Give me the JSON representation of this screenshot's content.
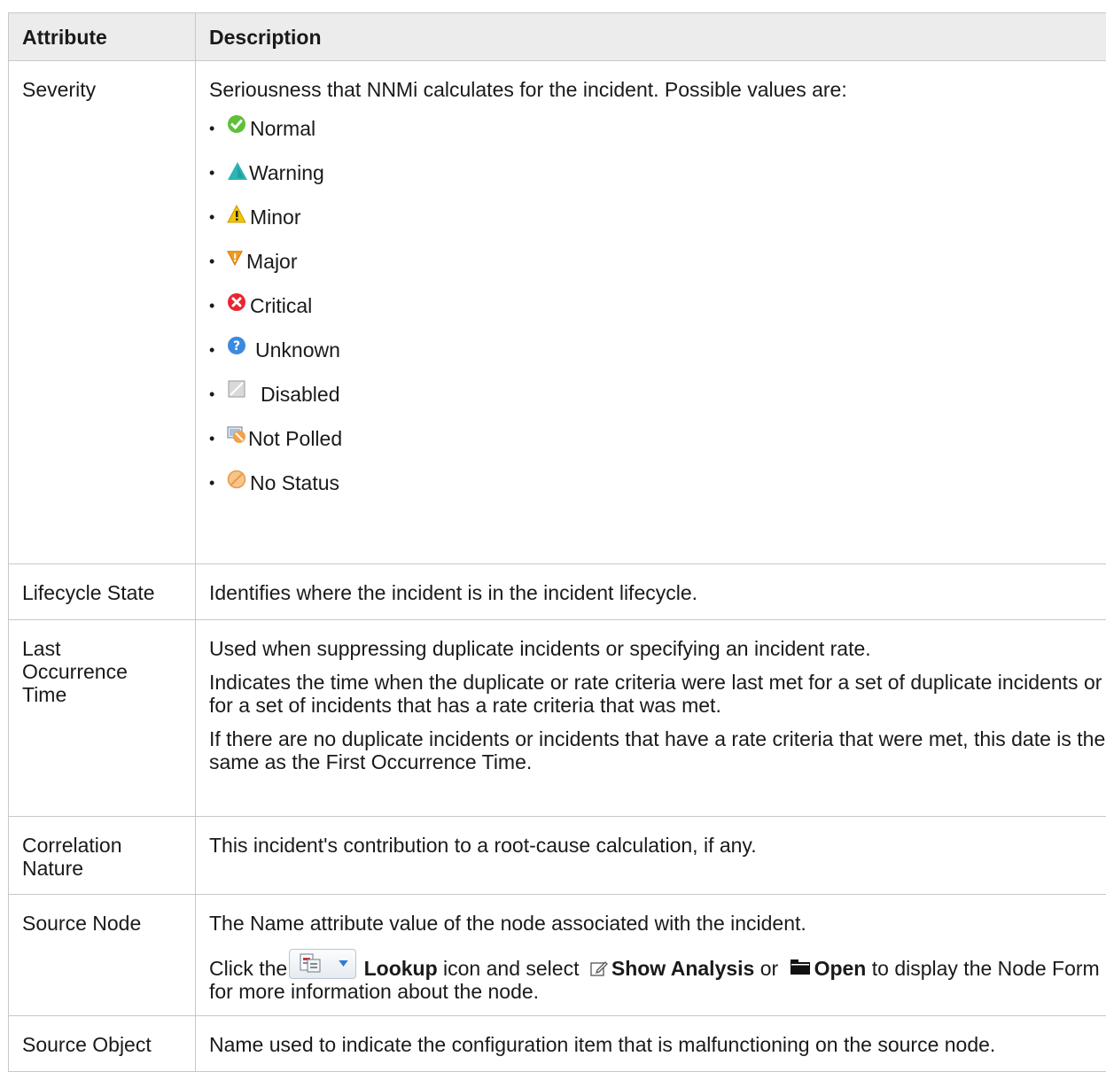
{
  "table": {
    "headers": {
      "attribute": "Attribute",
      "description": "Description"
    },
    "severity": {
      "attribute": "Severity",
      "intro": "Seriousness that NNMi calculates for the incident. Possible values are:",
      "values": [
        {
          "label": "Normal",
          "icon": "check-circle-icon",
          "color": "#5fbf3a"
        },
        {
          "label": "Warning",
          "icon": "triangle-up-icon",
          "color": "#2bb5b5"
        },
        {
          "label": "Minor",
          "icon": "warning-triangle-icon",
          "color": "#f2c600"
        },
        {
          "label": "Major",
          "icon": "triangle-down-icon",
          "color": "#f29a18"
        },
        {
          "label": "Critical",
          "icon": "x-circle-icon",
          "color": "#e8262f"
        },
        {
          "label": "Unknown",
          "icon": "question-circle-icon",
          "color": "#3a8ae0"
        },
        {
          "label": "Disabled",
          "icon": "disabled-square-icon",
          "color": "#c4c4c4"
        },
        {
          "label": "Not Polled",
          "icon": "not-polled-icon",
          "color": "#f2a24a"
        },
        {
          "label": "No Status",
          "icon": "no-status-icon",
          "color": "#f5b97a"
        }
      ]
    },
    "lifecycle": {
      "attribute": "Lifecycle State",
      "desc": "Identifies where the incident is in the incident lifecycle."
    },
    "last_occurrence": {
      "attribute": "Last Occurrence Time",
      "p1": "Used when suppressing duplicate incidents or specifying an incident rate.",
      "p2": "Indicates the time when the duplicate or rate criteria were last met for a set of duplicate incidents or for a set of incidents that has a rate criteria that was met.",
      "p3": "If there are no duplicate incidents or incidents that have a rate criteria that were met, this date is the same as the First Occurrence Time."
    },
    "correlation": {
      "attribute": "Correlation Nature",
      "desc": "This incident's contribution to a root-cause calculation, if any."
    },
    "source_node": {
      "attribute": "Source Node",
      "p1": "The Name attribute value of the node associated with the incident.",
      "click_the": "Click the",
      "lookup": "Lookup",
      "icon_and_select": "icon and select",
      "show_analysis": "Show Analysis",
      "or": "or",
      "open": "Open",
      "to_display": "to display the Node Form for more information about the node."
    },
    "source_object": {
      "attribute": "Source Object",
      "desc": "Name used to indicate the configuration item that is malfunctioning on the source node."
    }
  }
}
